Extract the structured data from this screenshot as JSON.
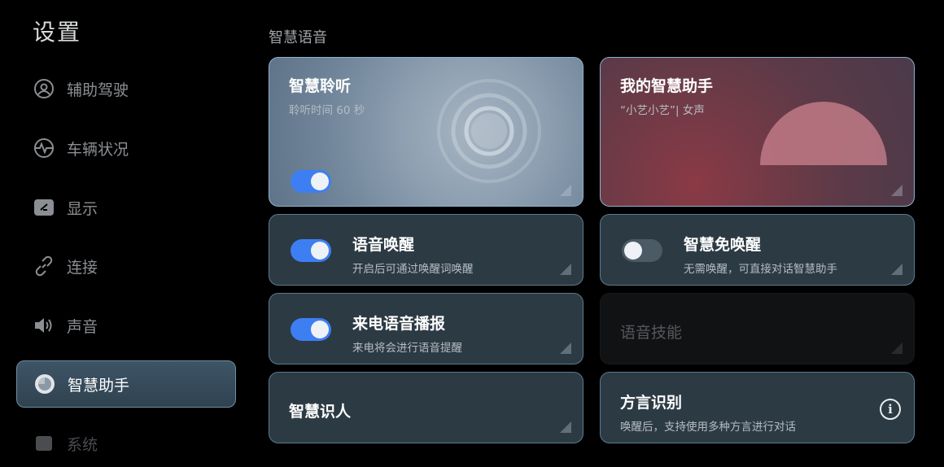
{
  "sidebar": {
    "title": "设置",
    "items": [
      {
        "label": "辅助驾驶",
        "icon": "driver-assist-icon"
      },
      {
        "label": "车辆状况",
        "icon": "vehicle-status-icon"
      },
      {
        "label": "显示",
        "icon": "display-icon"
      },
      {
        "label": "连接",
        "icon": "link-icon"
      },
      {
        "label": "声音",
        "icon": "speaker-icon"
      },
      {
        "label": "智慧助手",
        "icon": "assistant-icon",
        "active": true
      },
      {
        "label": "系统",
        "icon": "system-icon"
      }
    ]
  },
  "main": {
    "section_title": "智慧语音",
    "cards": {
      "smart_listen": {
        "title": "智慧聆听",
        "subtitle": "聆听时间 60 秒",
        "toggle_on": true
      },
      "my_assistant": {
        "title": "我的智慧助手",
        "subtitle": "“小艺小艺”| 女声"
      },
      "voice_wake": {
        "title": "语音唤醒",
        "subtitle": "开启后可通过唤醒词唤醒",
        "toggle_on": true
      },
      "free_wake": {
        "title": "智慧免唤醒",
        "subtitle": "无需唤醒，可直接对话智慧助手",
        "toggle_on": false
      },
      "call_announce": {
        "title": "来电语音播报",
        "subtitle": "来电将会进行语音提醒",
        "toggle_on": true
      },
      "voice_skills": {
        "title": "语音技能",
        "disabled": true
      },
      "face_id": {
        "title": "智慧识人"
      },
      "dialect": {
        "title": "方言识别",
        "subtitle": "唤醒后，支持使用多种方言进行对话",
        "icon": "info-icon"
      }
    }
  },
  "colors": {
    "toggle_on": "#3d7ff2",
    "card_bg": "#2c3a44",
    "card_border": "#5c7a8e",
    "active_nav_bg": "#3e5566"
  }
}
